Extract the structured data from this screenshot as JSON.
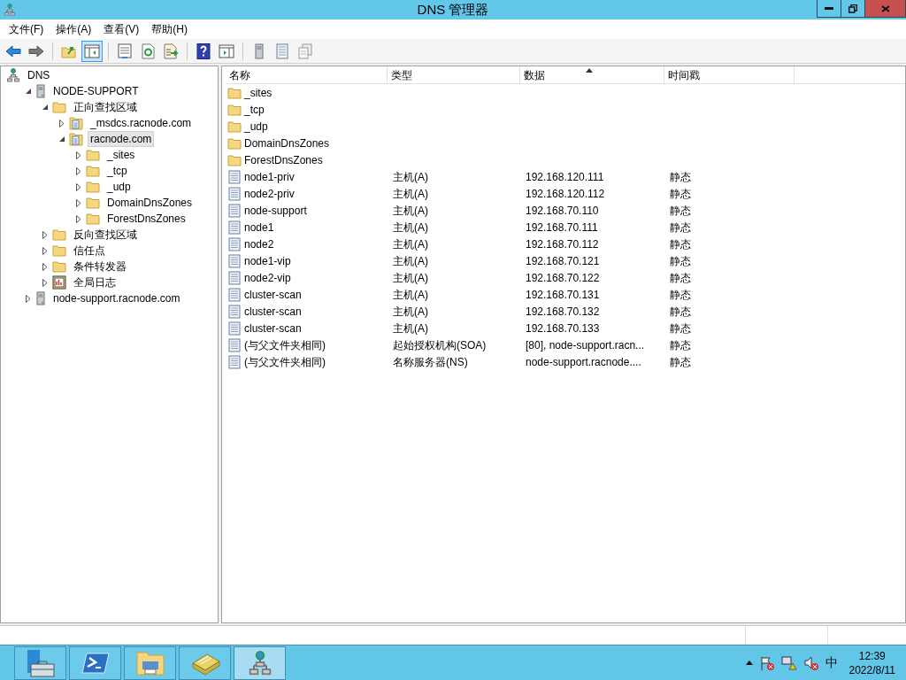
{
  "window": {
    "title": "DNS 管理器"
  },
  "menu": [
    "文件(F)",
    "操作(A)",
    "查看(V)",
    "帮助(H)"
  ],
  "toolbar": [
    {
      "kind": "back",
      "pressed": false
    },
    {
      "kind": "forward",
      "pressed": false
    },
    {
      "kind": "sep"
    },
    {
      "kind": "up",
      "pressed": false
    },
    {
      "kind": "tree",
      "pressed": true
    },
    {
      "kind": "sep"
    },
    {
      "kind": "props",
      "pressed": false
    },
    {
      "kind": "refresh",
      "pressed": false
    },
    {
      "kind": "export",
      "pressed": false
    },
    {
      "kind": "sep"
    },
    {
      "kind": "help",
      "pressed": false
    },
    {
      "kind": "action",
      "pressed": false
    },
    {
      "kind": "sep"
    },
    {
      "kind": "server",
      "pressed": false
    },
    {
      "kind": "list",
      "pressed": false
    },
    {
      "kind": "copy",
      "pressed": false
    }
  ],
  "tree": [
    {
      "label": "DNS",
      "kind": "dns",
      "selected": false,
      "children": [
        {
          "label": "NODE-SUPPORT",
          "kind": "server",
          "expanded": true,
          "selected": false,
          "children": [
            {
              "label": "正向查找区域",
              "kind": "folder",
              "expanded": true,
              "selected": false,
              "children": [
                {
                  "label": "_msdcs.racnode.com",
                  "kind": "zone",
                  "expanded": false,
                  "selected": false
                },
                {
                  "label": "racnode.com",
                  "kind": "zone",
                  "expanded": true,
                  "selected": true,
                  "children": [
                    {
                      "label": "_sites",
                      "kind": "folder",
                      "expanded": false,
                      "selected": false
                    },
                    {
                      "label": "_tcp",
                      "kind": "folder",
                      "expanded": false,
                      "selected": false
                    },
                    {
                      "label": "_udp",
                      "kind": "folder",
                      "expanded": false,
                      "selected": false
                    },
                    {
                      "label": "DomainDnsZones",
                      "kind": "folder",
                      "expanded": false,
                      "selected": false
                    },
                    {
                      "label": "ForestDnsZones",
                      "kind": "folder",
                      "expanded": false,
                      "selected": false
                    }
                  ]
                }
              ]
            },
            {
              "label": "反向查找区域",
              "kind": "folder",
              "expanded": false,
              "selected": false
            },
            {
              "label": "信任点",
              "kind": "folder",
              "expanded": false,
              "selected": false
            },
            {
              "label": "条件转发器",
              "kind": "folder",
              "expanded": false,
              "selected": false
            },
            {
              "label": "全局日志",
              "kind": "log",
              "expanded": false,
              "selected": false
            }
          ]
        },
        {
          "label": "node-support.racnode.com",
          "kind": "server",
          "expanded": false,
          "selected": false
        }
      ]
    }
  ],
  "table": {
    "columns": [
      {
        "label": "名称",
        "sorted": false
      },
      {
        "label": "类型",
        "sorted": false
      },
      {
        "label": "数据",
        "sorted": true
      },
      {
        "label": "时间戳",
        "sorted": false
      }
    ],
    "rows": [
      {
        "kind": "folder",
        "cells": [
          "_sites"
        ]
      },
      {
        "kind": "folder",
        "cells": [
          "_tcp"
        ]
      },
      {
        "kind": "folder",
        "cells": [
          "_udp"
        ]
      },
      {
        "kind": "folder",
        "cells": [
          "DomainDnsZones"
        ]
      },
      {
        "kind": "folder",
        "cells": [
          "ForestDnsZones"
        ]
      },
      {
        "kind": "record",
        "cells": [
          "node1-priv",
          "主机(A)",
          "192.168.120.111",
          "静态"
        ]
      },
      {
        "kind": "record",
        "cells": [
          "node2-priv",
          "主机(A)",
          "192.168.120.112",
          "静态"
        ]
      },
      {
        "kind": "record",
        "cells": [
          "node-support",
          "主机(A)",
          "192.168.70.110",
          "静态"
        ]
      },
      {
        "kind": "record",
        "cells": [
          "node1",
          "主机(A)",
          "192.168.70.111",
          "静态"
        ]
      },
      {
        "kind": "record",
        "cells": [
          "node2",
          "主机(A)",
          "192.168.70.112",
          "静态"
        ]
      },
      {
        "kind": "record",
        "cells": [
          "node1-vip",
          "主机(A)",
          "192.168.70.121",
          "静态"
        ]
      },
      {
        "kind": "record",
        "cells": [
          "node2-vip",
          "主机(A)",
          "192.168.70.122",
          "静态"
        ]
      },
      {
        "kind": "record",
        "cells": [
          "cluster-scan",
          "主机(A)",
          "192.168.70.131",
          "静态"
        ]
      },
      {
        "kind": "record",
        "cells": [
          "cluster-scan",
          "主机(A)",
          "192.168.70.132",
          "静态"
        ]
      },
      {
        "kind": "record",
        "cells": [
          "cluster-scan",
          "主机(A)",
          "192.168.70.133",
          "静态"
        ]
      },
      {
        "kind": "record",
        "cells": [
          "(与父文件夹相同)",
          "起始授权机构(SOA)",
          "[80], node-support.racn...",
          "静态"
        ]
      },
      {
        "kind": "record",
        "cells": [
          "(与父文件夹相同)",
          "名称服务器(NS)",
          "node-support.racnode....",
          "静态"
        ]
      }
    ]
  },
  "taskbar": {
    "apps": [
      {
        "kind": "server-manager",
        "selected": false
      },
      {
        "kind": "powershell",
        "selected": false
      },
      {
        "kind": "explorer",
        "selected": false
      },
      {
        "kind": "tools",
        "selected": false
      },
      {
        "kind": "dns",
        "selected": true
      }
    ],
    "ime": "中",
    "time": "12:39",
    "date": "2022/8/11"
  }
}
